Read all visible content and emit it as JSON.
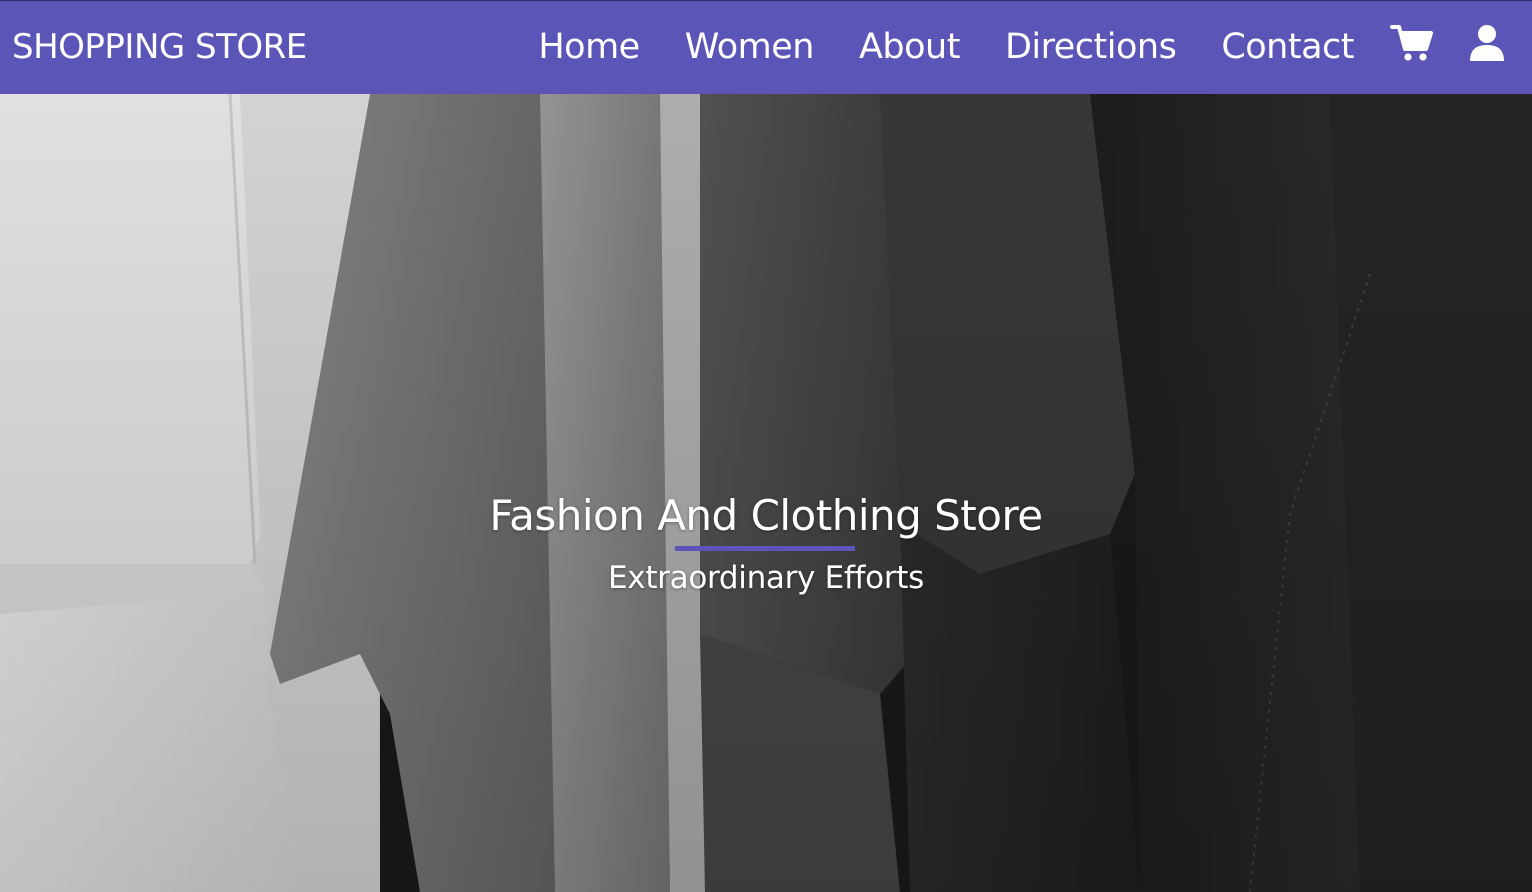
{
  "navbar": {
    "brand": "SHOPPING STORE",
    "links": [
      {
        "label": "Home"
      },
      {
        "label": "Women"
      },
      {
        "label": "About"
      },
      {
        "label": "Directions"
      },
      {
        "label": "Contact"
      }
    ],
    "icons": [
      "cart-icon",
      "user-icon"
    ],
    "background_color": "#5b55b8"
  },
  "hero": {
    "title": "Fashion And Clothing Store",
    "subtitle": "Extraordinary Efforts",
    "underline_color": "#5b55b8"
  }
}
